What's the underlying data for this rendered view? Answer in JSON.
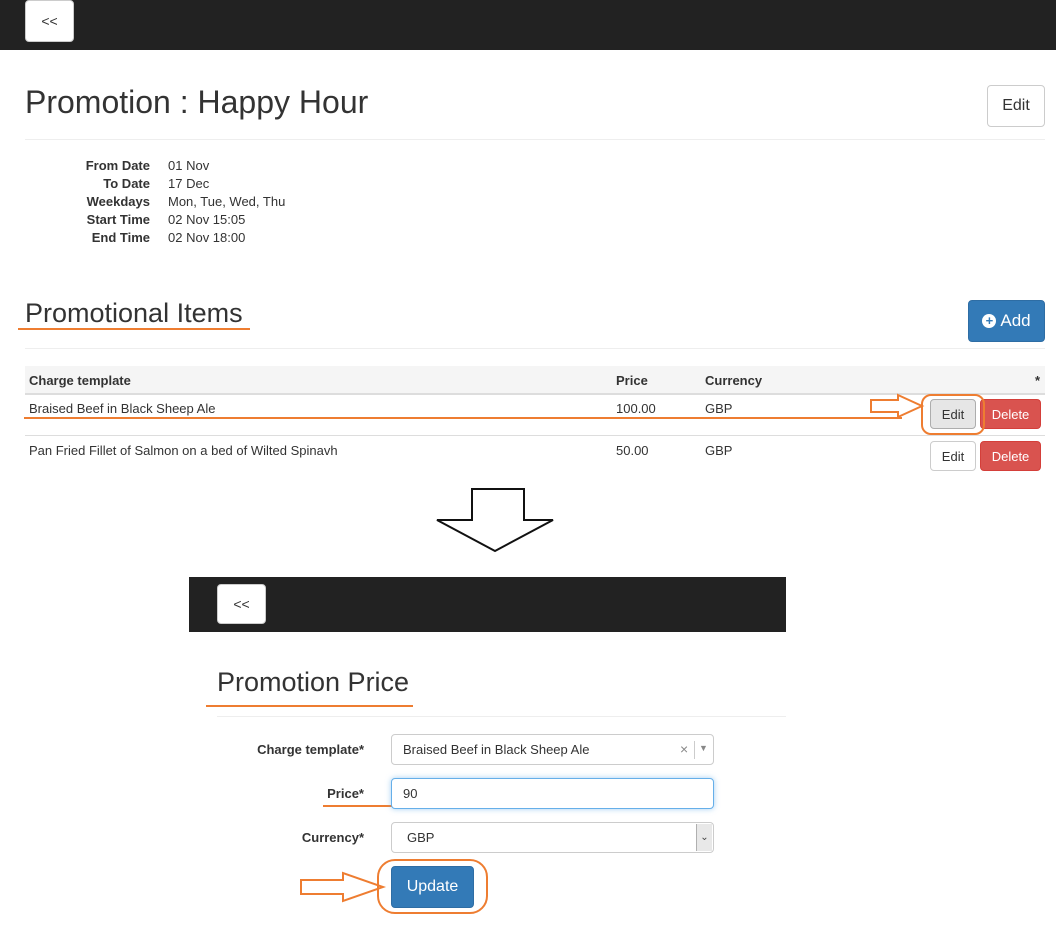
{
  "main": {
    "back_label": "<<",
    "title": "Promotion : Happy Hour",
    "edit_label": "Edit",
    "details": [
      {
        "label": "From Date",
        "value": "01 Nov"
      },
      {
        "label": "To Date",
        "value": "17 Dec"
      },
      {
        "label": "Weekdays",
        "value": "Mon, Tue, Wed, Thu"
      },
      {
        "label": "Start Time",
        "value": "02 Nov 15:05"
      },
      {
        "label": "End Time",
        "value": "02 Nov 18:00"
      }
    ],
    "section_title": "Promotional Items",
    "add_label": "Add",
    "table": {
      "headers": {
        "charge_template": "Charge template",
        "price": "Price",
        "currency": "Currency",
        "actions": "*"
      },
      "rows": [
        {
          "charge_template": "Braised Beef in Black Sheep Ale",
          "price": "100.00",
          "currency": "GBP",
          "edit": "Edit",
          "delete": "Delete"
        },
        {
          "charge_template": "Pan Fried Fillet of Salmon on a bed of Wilted Spinavh",
          "price": "50.00",
          "currency": "GBP",
          "edit": "Edit",
          "delete": "Delete"
        }
      ]
    }
  },
  "edit_form": {
    "back_label": "<<",
    "title": "Promotion Price",
    "charge_template_label": "Charge template*",
    "charge_template_value": "Braised Beef in Black Sheep Ale",
    "clear_icon": "×",
    "price_label": "Price*",
    "price_value": "90",
    "currency_label": "Currency*",
    "currency_value": "GBP",
    "update_label": "Update"
  },
  "colors": {
    "topbar": "#222222",
    "primary": "#337ab7",
    "danger": "#d9534f",
    "annotation": "#ee7d31"
  }
}
